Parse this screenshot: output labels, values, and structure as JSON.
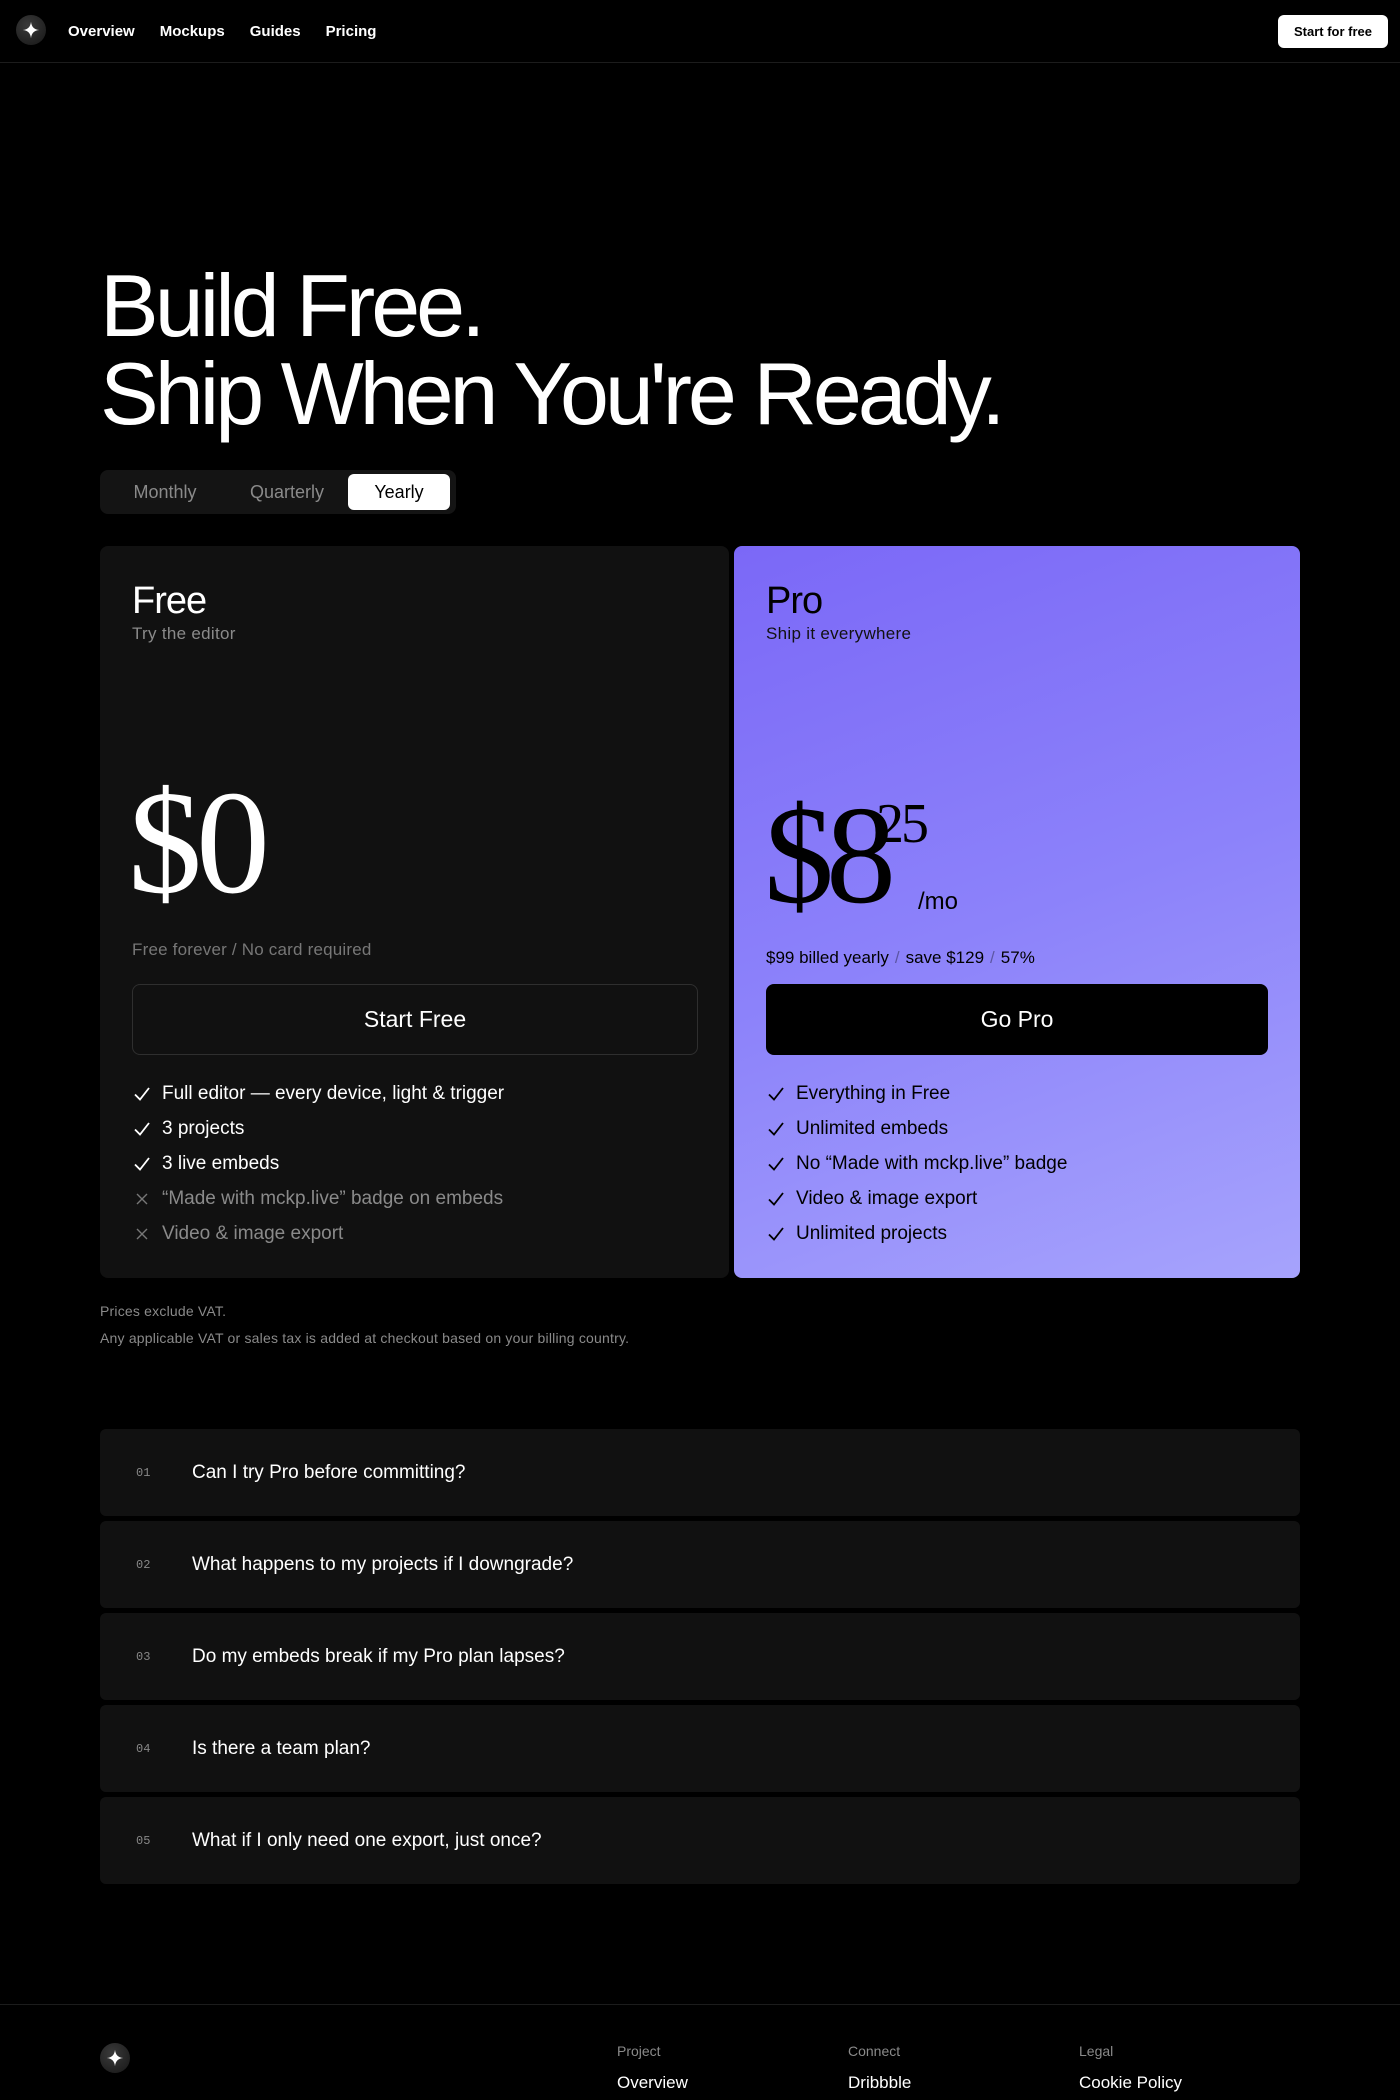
{
  "nav": {
    "logo_icon": "sparkle-icon",
    "links": [
      "Overview",
      "Mockups",
      "Guides",
      "Pricing"
    ],
    "cta": "Start for free"
  },
  "hero": {
    "line1": "Build Free.",
    "line2": "Ship When You're Ready."
  },
  "billing": {
    "options": [
      "Monthly",
      "Quarterly",
      "Yearly"
    ],
    "selected": "Yearly"
  },
  "plans": {
    "free": {
      "name": "Free",
      "subtitle": "Try the editor",
      "price": "$0",
      "note": "Free forever / No card required",
      "button": "Start Free",
      "features": [
        {
          "text": "Full editor — every device, light & trigger",
          "included": true
        },
        {
          "text": "3 projects",
          "included": true
        },
        {
          "text": "3 live embeds",
          "included": true
        },
        {
          "text": "“Made with mckp.live” badge on embeds",
          "included": false
        },
        {
          "text": "Video & image export",
          "included": false
        }
      ]
    },
    "pro": {
      "name": "Pro",
      "subtitle": "Ship it everywhere",
      "price_whole": "$8",
      "price_cents": "25",
      "per": "/mo",
      "billed": "$99 billed yearly",
      "save": "save $129",
      "discount": "57%",
      "button": "Go Pro",
      "features": [
        {
          "text": "Everything in Free",
          "included": true
        },
        {
          "text": "Unlimited embeds",
          "included": true
        },
        {
          "text": "No “Made with mckp.live” badge",
          "included": true
        },
        {
          "text": "Video & image export",
          "included": true
        },
        {
          "text": "Unlimited projects",
          "included": true
        }
      ]
    }
  },
  "vat": {
    "line1": "Prices exclude VAT.",
    "line2": "Any applicable VAT or sales tax is added at checkout based on your billing country."
  },
  "faq": [
    {
      "num": "01",
      "q": "Can I try Pro before committing?"
    },
    {
      "num": "02",
      "q": "What happens to my projects if I downgrade?"
    },
    {
      "num": "03",
      "q": "Do my embeds break if my Pro plan lapses?"
    },
    {
      "num": "04",
      "q": "Is there a team plan?"
    },
    {
      "num": "05",
      "q": "What if I only need one export, just once?"
    }
  ],
  "footer": {
    "columns": [
      {
        "heading": "Project",
        "first_link": "Overview"
      },
      {
        "heading": "Connect",
        "first_link": "Dribbble"
      },
      {
        "heading": "Legal",
        "first_link": "Cookie Policy"
      }
    ]
  },
  "colors": {
    "background": "#000000",
    "card_free": "#111111",
    "pro_gradient_start": "#7b68f7",
    "pro_gradient_end": "#a6a3fc"
  }
}
